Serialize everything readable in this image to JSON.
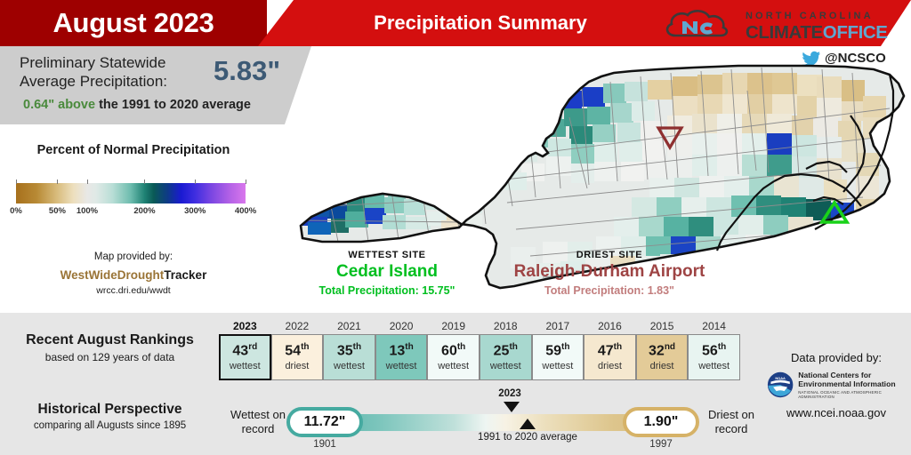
{
  "header": {
    "month_title": "August 2023",
    "summary_title": "Precipitation Summary",
    "band_dark_red": "#9e0000",
    "band_red": "#d40f0f"
  },
  "logo": {
    "wordmark_top": "NORTH CAROLINA",
    "wordmark_climate": "CLIMATE",
    "wordmark_office": "OFFICE",
    "cloud_icon": "cloud-nc-monogram-icon",
    "twitter_icon": "twitter-bird-icon",
    "twitter_handle": "@NCSCO"
  },
  "stat": {
    "label": "Preliminary Statewide Average Precipitation:",
    "value": "5.83\"",
    "value_color": "#3d5a75",
    "departure": "0.64\" above",
    "departure_color": "#4a8a3c",
    "departure_rest": " the 1991 to 2020 average"
  },
  "legend": {
    "title": "Percent of Normal Precipitation",
    "ticks": [
      "0%",
      "50%",
      "100%",
      "200%",
      "300%",
      "400%"
    ],
    "tick_positions_pct": [
      0,
      18,
      31,
      56,
      78,
      100
    ],
    "credit_lead": "Map provided by:",
    "credit_brand_1": "WestWideDrought",
    "credit_brand_2": "Tracker",
    "credit_url": "wrcc.dri.edu/wwdt"
  },
  "sites": {
    "wettest": {
      "kicker": "WETTEST SITE",
      "name": "Cedar Island",
      "total": "Total Precipitation: 15.75\"",
      "color": "#00bf1f",
      "marker_icon": "triangle-up-marker-icon"
    },
    "driest": {
      "kicker": "DRIEST SITE",
      "name": "Raleigh-Durham Airport",
      "total": "Total Precipitation: 1.83\"",
      "color": "#9e4444",
      "marker_icon": "triangle-down-marker-icon"
    }
  },
  "rankings": {
    "heading": "Recent August Rankings",
    "subheading": "based on 129 years of data",
    "rows": [
      {
        "year": "2023",
        "rank": "43",
        "suffix": "rd",
        "label": "wettest",
        "fill": "#cde6e0",
        "current": true
      },
      {
        "year": "2022",
        "rank": "54",
        "suffix": "th",
        "label": "driest",
        "fill": "#fbf0dd",
        "current": false
      },
      {
        "year": "2021",
        "rank": "35",
        "suffix": "th",
        "label": "wettest",
        "fill": "#b9ded6",
        "current": false
      },
      {
        "year": "2020",
        "rank": "13",
        "suffix": "th",
        "label": "wettest",
        "fill": "#7ec8bb",
        "current": false
      },
      {
        "year": "2019",
        "rank": "60",
        "suffix": "th",
        "label": "wettest",
        "fill": "#f2faf8",
        "current": false
      },
      {
        "year": "2018",
        "rank": "25",
        "suffix": "th",
        "label": "wettest",
        "fill": "#a8d8cf",
        "current": false
      },
      {
        "year": "2017",
        "rank": "59",
        "suffix": "th",
        "label": "wettest",
        "fill": "#f2faf8",
        "current": false
      },
      {
        "year": "2016",
        "rank": "47",
        "suffix": "th",
        "label": "driest",
        "fill": "#f5e8cf",
        "current": false
      },
      {
        "year": "2015",
        "rank": "32",
        "suffix": "nd",
        "label": "driest",
        "fill": "#e3cb98",
        "current": false
      },
      {
        "year": "2014",
        "rank": "56",
        "suffix": "th",
        "label": "wettest",
        "fill": "#e8f4f1",
        "current": false
      }
    ]
  },
  "historical": {
    "heading": "Historical Perspective",
    "subheading": "comparing all Augusts since 1895",
    "wettest_label": "Wettest on record",
    "wettest_value": "11.72\"",
    "wettest_year": "1901",
    "driest_label": "Driest on record",
    "driest_value": "1.90\"",
    "driest_year": "1997",
    "current_marker_label": "2023",
    "average_marker_label": "1991 to 2020 average",
    "wet_ring_color": "#45aaa0",
    "dry_ring_color": "#d6b267"
  },
  "data_credit": {
    "lead": "Data provided by:",
    "agency_line_1": "National Centers for",
    "agency_line_2": "Environmental Information",
    "agency_sub": "NATIONAL OCEANIC AND ATMOSPHERIC ADMINISTRATION",
    "logo_icon": "noaa-seal-icon",
    "url": "www.ncei.noaa.gov"
  },
  "chart_data": {
    "type": "map",
    "title": "Percent of Normal Precipitation — North Carolina, August 2023",
    "colorbar_label": "Percent of Normal Precipitation",
    "colorbar_ticks": [
      "0%",
      "50%",
      "100%",
      "200%",
      "300%",
      "400%"
    ],
    "statewide_average_in": 5.83,
    "departure_from_normal_in": 0.64,
    "normal_1991_2020_in": 5.19,
    "wettest_site": {
      "name": "Cedar Island",
      "total_in": 15.75
    },
    "driest_site": {
      "name": "Raleigh-Durham Airport",
      "total_in": 1.83
    },
    "rank_2023": {
      "rank": 43,
      "of_years": 129,
      "direction": "wettest"
    },
    "record_wettest": {
      "value_in": 11.72,
      "year": 1901
    },
    "record_driest": {
      "value_in": 1.9,
      "year": 1997
    },
    "recent_rankings": {
      "years": [
        2023,
        2022,
        2021,
        2020,
        2019,
        2018,
        2017,
        2016,
        2015,
        2014
      ],
      "ranks": [
        43,
        54,
        35,
        13,
        60,
        25,
        59,
        47,
        32,
        56
      ],
      "directions": [
        "wettest",
        "driest",
        "wettest",
        "wettest",
        "wettest",
        "wettest",
        "wettest",
        "driest",
        "driest",
        "wettest"
      ]
    }
  }
}
